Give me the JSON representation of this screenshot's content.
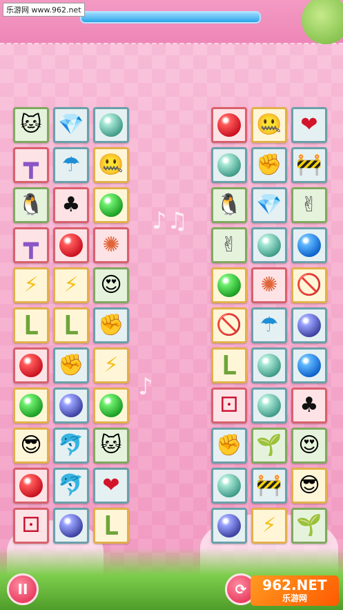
{
  "header": {
    "watermark": "乐游网 www.962.net",
    "timer_fraction": 1.0
  },
  "colors": {
    "timer_fill": "#2aa4e8",
    "accent": "#e0204a"
  },
  "boards": [
    {
      "name": "left",
      "rows": [
        [
          {
            "icon": "cat-icon",
            "glyph": "🐱",
            "frame": "green"
          },
          {
            "icon": "diamond-icon",
            "glyph": "💎",
            "frame": "blue"
          },
          {
            "icon": "teal-ball-icon",
            "glyph": "",
            "frame": "blue"
          }
        ],
        [
          {
            "icon": "t-block-icon",
            "glyph": "┳",
            "frame": "red"
          },
          {
            "icon": "umbrella-icon",
            "glyph": "☂",
            "frame": "blue"
          },
          {
            "icon": "zipped-mouth-face-icon",
            "glyph": "🤐",
            "frame": "orange"
          }
        ],
        [
          {
            "icon": "penguin-icon",
            "glyph": "🐧",
            "frame": "green"
          },
          {
            "icon": "club-icon",
            "glyph": "♣",
            "frame": "red"
          },
          {
            "icon": "green-ball-icon",
            "glyph": "",
            "frame": "orange"
          }
        ],
        [
          {
            "icon": "t-block-icon",
            "glyph": "┳",
            "frame": "red"
          },
          {
            "icon": "red-ball-icon",
            "glyph": "",
            "frame": "red"
          },
          {
            "icon": "pinwheel-icon",
            "glyph": "✺",
            "frame": "red"
          }
        ],
        [
          {
            "icon": "lightning-icon",
            "glyph": "⚡",
            "frame": "orange"
          },
          {
            "icon": "lightning-icon",
            "glyph": "⚡",
            "frame": "orange"
          },
          {
            "icon": "heart-eyes-face-icon",
            "glyph": "😍",
            "frame": "green"
          }
        ],
        [
          {
            "icon": "l-block-icon",
            "glyph": "L",
            "frame": "orange"
          },
          {
            "icon": "l-block-icon",
            "glyph": "L",
            "frame": "orange"
          },
          {
            "icon": "fist-icon",
            "glyph": "✊",
            "frame": "blue"
          }
        ],
        [
          {
            "icon": "red-ball-icon",
            "glyph": "",
            "frame": "red"
          },
          {
            "icon": "fist-icon",
            "glyph": "✊",
            "frame": "blue"
          },
          {
            "icon": "lightning-icon",
            "glyph": "⚡",
            "frame": "orange"
          }
        ],
        [
          {
            "icon": "green-ball-icon",
            "glyph": "",
            "frame": "orange"
          },
          {
            "icon": "violet-ball-icon",
            "glyph": "",
            "frame": "blue"
          },
          {
            "icon": "green-ball-icon",
            "glyph": "",
            "frame": "orange"
          }
        ],
        [
          {
            "icon": "sunglasses-face-icon",
            "glyph": "😎",
            "frame": "orange"
          },
          {
            "icon": "dolphin-icon",
            "glyph": "🐬",
            "frame": "blue"
          },
          {
            "icon": "cat-icon",
            "glyph": "🐱",
            "frame": "green"
          }
        ],
        [
          {
            "icon": "red-ball-icon",
            "glyph": "",
            "frame": "red"
          },
          {
            "icon": "dolphin-icon",
            "glyph": "🐬",
            "frame": "blue"
          },
          {
            "icon": "heart-icon",
            "glyph": "❤",
            "frame": "blue"
          }
        ],
        [
          {
            "icon": "dice-icon",
            "glyph": "⚀",
            "frame": "red"
          },
          {
            "icon": "violet-ball-icon",
            "glyph": "",
            "frame": "blue"
          },
          {
            "icon": "l-block-icon",
            "glyph": "L",
            "frame": "orange"
          }
        ]
      ]
    },
    {
      "name": "right",
      "rows": [
        [
          {
            "icon": "red-ball-icon",
            "glyph": "",
            "frame": "red"
          },
          {
            "icon": "zipped-mouth-face-icon",
            "glyph": "🤐",
            "frame": "orange"
          },
          {
            "icon": "heart-icon",
            "glyph": "❤",
            "frame": "blue"
          }
        ],
        [
          {
            "icon": "teal-ball-icon",
            "glyph": "",
            "frame": "blue"
          },
          {
            "icon": "fist-icon",
            "glyph": "✊",
            "frame": "blue"
          },
          {
            "icon": "barrier-icon",
            "glyph": "🚧",
            "frame": "blue"
          }
        ],
        [
          {
            "icon": "penguin-icon",
            "glyph": "🐧",
            "frame": "green"
          },
          {
            "icon": "diamond-icon",
            "glyph": "💎",
            "frame": "blue"
          },
          {
            "icon": "victory-hand-icon",
            "glyph": "✌",
            "frame": "green"
          }
        ],
        [
          {
            "icon": "victory-hand-icon",
            "glyph": "✌",
            "frame": "green"
          },
          {
            "icon": "teal-ball-icon",
            "glyph": "",
            "frame": "blue"
          },
          {
            "icon": "blue-ball-icon",
            "glyph": "",
            "frame": "blue"
          }
        ],
        [
          {
            "icon": "green-ball-icon",
            "glyph": "",
            "frame": "orange"
          },
          {
            "icon": "pinwheel-icon",
            "glyph": "✺",
            "frame": "red"
          },
          {
            "icon": "no-hand-icon",
            "glyph": "🚫",
            "frame": "orange"
          }
        ],
        [
          {
            "icon": "no-hand-icon",
            "glyph": "🚫",
            "frame": "orange"
          },
          {
            "icon": "umbrella-icon",
            "glyph": "☂",
            "frame": "blue"
          },
          {
            "icon": "violet-ball-icon",
            "glyph": "",
            "frame": "blue"
          }
        ],
        [
          {
            "icon": "l-block-icon",
            "glyph": "L",
            "frame": "orange"
          },
          {
            "icon": "teal-ball-icon",
            "glyph": "",
            "frame": "blue"
          },
          {
            "icon": "blue-ball-icon",
            "glyph": "",
            "frame": "blue"
          }
        ],
        [
          {
            "icon": "dice-icon",
            "glyph": "⚀",
            "frame": "red"
          },
          {
            "icon": "teal-ball-icon",
            "glyph": "",
            "frame": "blue"
          },
          {
            "icon": "club-icon",
            "glyph": "♣",
            "frame": "red"
          }
        ],
        [
          {
            "icon": "fist-icon",
            "glyph": "✊",
            "frame": "blue"
          },
          {
            "icon": "piranha-plant-icon",
            "glyph": "🌱",
            "frame": "green"
          },
          {
            "icon": "heart-eyes-face-icon",
            "glyph": "😍",
            "frame": "green"
          }
        ],
        [
          {
            "icon": "teal-ball-icon",
            "glyph": "",
            "frame": "blue"
          },
          {
            "icon": "barrier-icon",
            "glyph": "🚧",
            "frame": "blue"
          },
          {
            "icon": "sunglasses-face-icon",
            "glyph": "😎",
            "frame": "orange"
          }
        ],
        [
          {
            "icon": "violet-ball-icon",
            "glyph": "",
            "frame": "blue"
          },
          {
            "icon": "lightning-icon",
            "glyph": "⚡",
            "frame": "orange"
          },
          {
            "icon": "piranha-plant-icon",
            "glyph": "🌱",
            "frame": "green"
          }
        ]
      ]
    }
  ],
  "footer": {
    "pause_glyph": "II",
    "refresh_glyph": "⟳",
    "logo_big": "962.NET",
    "logo_small": "乐游网"
  }
}
